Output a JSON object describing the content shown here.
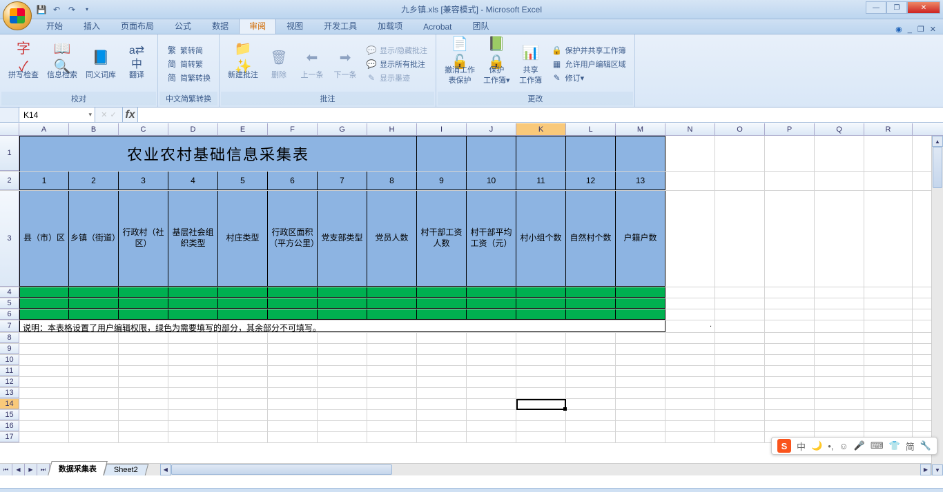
{
  "window": {
    "title": "九乡镇.xls  [兼容模式] - Microsoft Excel"
  },
  "qat": {
    "save": "💾",
    "undo": "↶",
    "redo": "↷"
  },
  "tabs": {
    "items": [
      "开始",
      "插入",
      "页面布局",
      "公式",
      "数据",
      "审阅",
      "视图",
      "开发工具",
      "加载项",
      "Acrobat",
      "团队"
    ],
    "active": "审阅"
  },
  "ribbon": {
    "g1": {
      "label": "校对",
      "spell": "拼写检查",
      "research": "信息检索",
      "thesaurus": "同义词库",
      "translate": "翻译"
    },
    "g2": {
      "label": "中文简繁转换",
      "b1": "繁转简",
      "b2": "简转繁",
      "b3": "简繁转换"
    },
    "g3": {
      "label": "批注",
      "new": "新建批注",
      "del": "删除",
      "prev": "上一条",
      "next": "下一条",
      "show1": "显示/隐藏批注",
      "show2": "显示所有批注",
      "show3": "显示墨迹"
    },
    "g4": {
      "label": "更改",
      "b1a": "撤消工作",
      "b1b": "表保护",
      "b2a": "保护",
      "b2b": "工作簿▾",
      "b3a": "共享",
      "b3b": "工作簿",
      "b4": "保护并共享工作簿",
      "b5": "允许用户编辑区域",
      "b6": "修订▾"
    }
  },
  "namebox": "K14",
  "fx": "fx",
  "cols": [
    "A",
    "B",
    "C",
    "D",
    "E",
    "F",
    "G",
    "H",
    "I",
    "J",
    "K",
    "L",
    "M",
    "N",
    "O",
    "P",
    "Q",
    "R"
  ],
  "active_col": "K",
  "chart_data": {
    "type": "table",
    "title": "农业农村基础信息采集表",
    "col_nums": [
      "1",
      "2",
      "3",
      "4",
      "5",
      "6",
      "7",
      "8",
      "9",
      "10",
      "11",
      "12",
      "13"
    ],
    "headers": [
      "县（市）区",
      "乡镇（街道）",
      "行政村（社区）",
      "基层社会组织类型",
      "村庄类型",
      "行政区面积（平方公里）",
      "党支部类型",
      "党员人数",
      "村干部工资人数",
      "村干部平均工资（元）",
      "村小组个数",
      "自然村个数",
      "户籍户数"
    ],
    "note": "说明：本表格设置了用户编辑权限，绿色为需要填写的部分，其余部分不可填写。"
  },
  "sheets": {
    "s1": "数据采集表",
    "s2": "Sheet2"
  },
  "ime": {
    "logo": "S",
    "t1": "中",
    "t2": "🌙",
    "t3": "•,",
    "t4": "☺",
    "t5": "🎤",
    "t6": "⌨",
    "t7": "👕",
    "t8": "简",
    "t9": "🔧"
  }
}
